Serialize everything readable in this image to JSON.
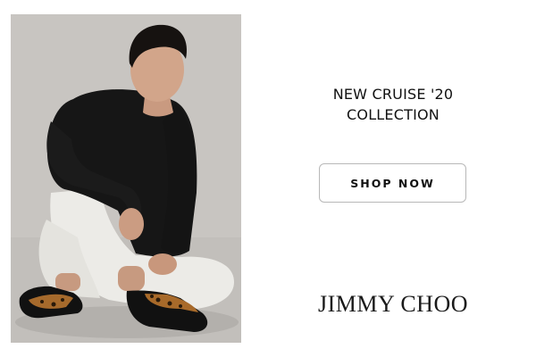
{
  "banner": {
    "headline_line1": "NEW CRUISE '20",
    "headline_line2": "COLLECTION",
    "cta_label": "SHOP NOW",
    "brand_logo": "JIMMY CHOO"
  },
  "colors": {
    "background": "#ffffff",
    "photo_backdrop": "#c9c6c2",
    "text": "#111111",
    "button_border": "#b8b8b8"
  }
}
